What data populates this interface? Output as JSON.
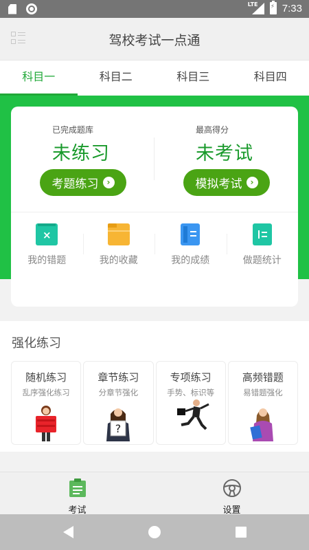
{
  "status_bar": {
    "network": "LTE",
    "time": "7:33"
  },
  "app": {
    "title": "驾校考试一点通"
  },
  "tabs": [
    {
      "label": "科目一",
      "active": true
    },
    {
      "label": "科目二",
      "active": false
    },
    {
      "label": "科目三",
      "active": false
    },
    {
      "label": "科目四",
      "active": false
    }
  ],
  "summary": {
    "practice": {
      "caption": "已完成题库",
      "value": "未练习",
      "button": "考题练习"
    },
    "exam": {
      "caption": "最高得分",
      "value": "未考试",
      "button": "模拟考试"
    }
  },
  "quick_actions": [
    {
      "label": "我的错题",
      "icon": "wrong-questions-icon",
      "color": "#1fc6a4"
    },
    {
      "label": "我的收藏",
      "icon": "folder-icon",
      "color": "#f7b534"
    },
    {
      "label": "我的成绩",
      "icon": "scores-icon",
      "color": "#3b96f1"
    },
    {
      "label": "做题统计",
      "icon": "statistics-icon",
      "color": "#1fc6a4"
    }
  ],
  "section": {
    "title": "强化练习",
    "cards": [
      {
        "title": "随机练习",
        "subtitle": "乱序强化练习"
      },
      {
        "title": "章节练习",
        "subtitle": "分章节强化"
      },
      {
        "title": "专项练习",
        "subtitle": "手势、标识等"
      },
      {
        "title": "高频错题",
        "subtitle": "易错题强化"
      }
    ]
  },
  "bottom_nav": [
    {
      "label": "考试",
      "icon": "clipboard-icon",
      "active": true
    },
    {
      "label": "设置",
      "icon": "steering-wheel-icon",
      "active": false
    }
  ],
  "colors": {
    "accent": "#20a838",
    "band": "#20c145",
    "button": "#4aa414"
  }
}
